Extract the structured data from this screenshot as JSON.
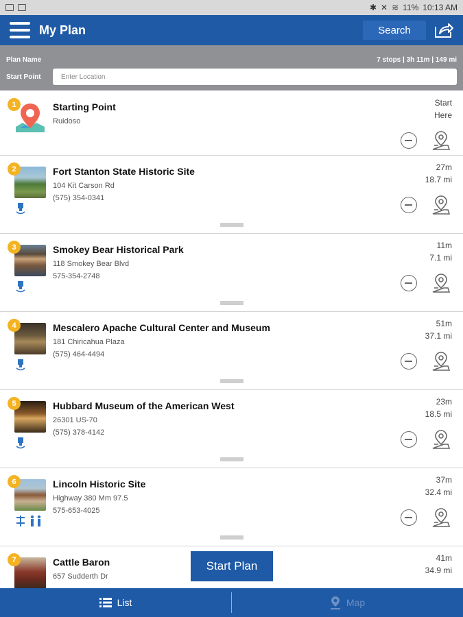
{
  "status_bar": {
    "battery": "11%",
    "time": "10:13 AM"
  },
  "header": {
    "title": "My Plan",
    "search_label": "Search"
  },
  "plan": {
    "name_label": "Plan Name",
    "stats": "7 stops | 3h 11m | 149 mi",
    "start_label": "Start Point",
    "start_placeholder": "Enter Location"
  },
  "stops": [
    {
      "num": "1",
      "name": "Starting Point",
      "addr": "Ruidoso",
      "phone": "",
      "time": "Start",
      "dist": "Here"
    },
    {
      "num": "2",
      "name": "Fort Stanton State Historic Site",
      "addr": "104 Kit Carson Rd",
      "phone": "(575) 354-0341",
      "time": "27m",
      "dist": "18.7 mi"
    },
    {
      "num": "3",
      "name": "Smokey Bear Historical Park",
      "addr": "118 Smokey Bear Blvd",
      "phone": "575-354-2748",
      "time": "11m",
      "dist": "7.1 mi"
    },
    {
      "num": "4",
      "name": "Mescalero Apache Cultural Center and Museum",
      "addr": "181 Chiricahua Plaza",
      "phone": "(575) 464-4494",
      "time": "51m",
      "dist": "37.1 mi"
    },
    {
      "num": "5",
      "name": "Hubbard Museum of the American West",
      "addr": "26301 US-70",
      "phone": "(575) 378-4142",
      "time": "23m",
      "dist": "18.5 mi"
    },
    {
      "num": "6",
      "name": "Lincoln Historic Site",
      "addr": "Highway 380 Mm 97.5",
      "phone": "575-653-4025",
      "time": "37m",
      "dist": "32.4 mi"
    },
    {
      "num": "7",
      "name": "Cattle Baron",
      "addr": "657 Sudderth Dr",
      "phone": "",
      "time": "41m",
      "dist": "34.9 mi"
    }
  ],
  "start_plan_label": "Start Plan",
  "tabs": {
    "list": "List",
    "map": "Map"
  },
  "colors": {
    "primary": "#1f5aa6",
    "badge": "#f4b323",
    "plan_bar": "#8f9194"
  }
}
